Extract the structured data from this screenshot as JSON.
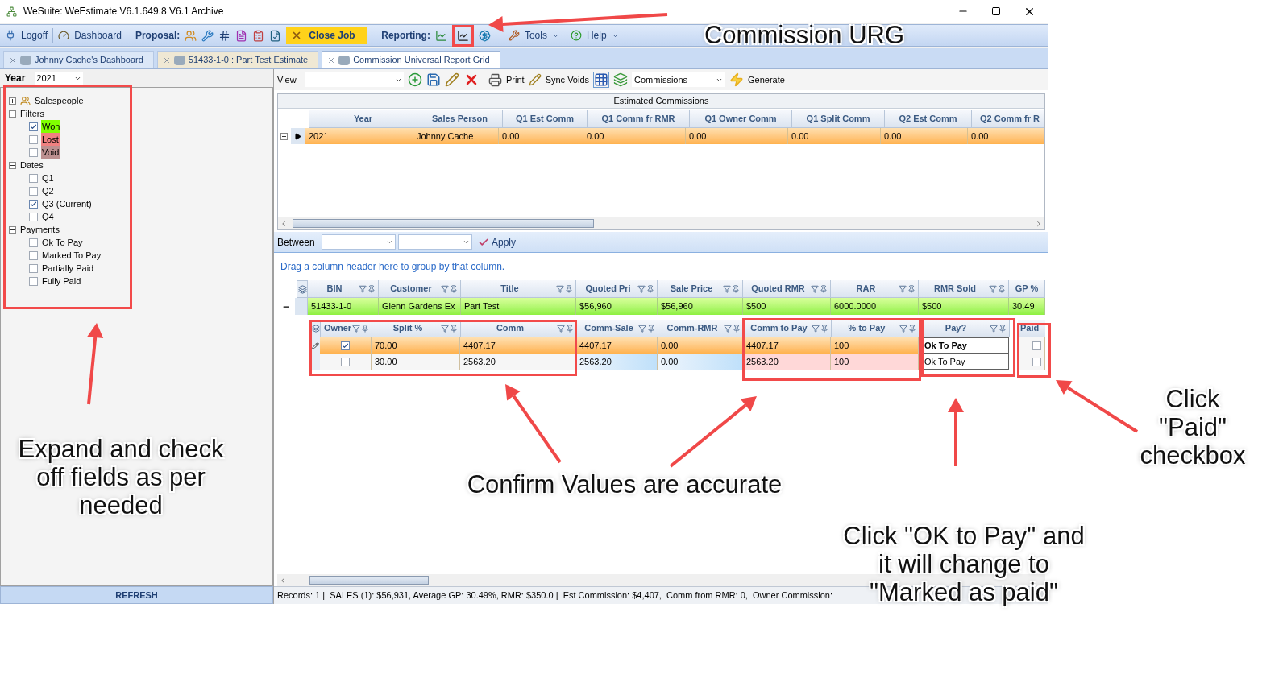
{
  "window": {
    "title": "WeSuite: WeEstimate V6.1.649.8 V6.1 Archive"
  },
  "toolbar": {
    "logoff": "Logoff",
    "dashboard": "Dashboard",
    "proposal_label": "Proposal:",
    "close_job": "Close Job",
    "reporting_label": "Reporting:",
    "menus": [
      "Tools",
      "Help"
    ]
  },
  "tabs": [
    {
      "label": "Johnny Cache's Dashboard",
      "selected": false
    },
    {
      "label": "51433-1-0 : Part Test Estimate",
      "selected": false
    },
    {
      "label": "Commission Universal Report Grid",
      "selected": true
    }
  ],
  "filter_panel": {
    "year_label": "Year",
    "year_value": "2021",
    "refresh": "REFRESH",
    "tree": [
      {
        "label": "Salespeople",
        "expanded": false
      },
      {
        "label": "Filters",
        "expanded": true,
        "children": [
          {
            "label": "Won",
            "checked": true,
            "color": "#80ff00"
          },
          {
            "label": "Lost",
            "checked": false,
            "color": "#f08080"
          },
          {
            "label": "Void",
            "checked": false,
            "color": "#bc8f8f"
          }
        ]
      },
      {
        "label": "Dates",
        "expanded": true,
        "children": [
          {
            "label": "Q1",
            "checked": false
          },
          {
            "label": "Q2",
            "checked": false
          },
          {
            "label": "Q3 (Current)",
            "checked": true
          },
          {
            "label": "Q4",
            "checked": false
          }
        ]
      },
      {
        "label": "Payments",
        "expanded": true,
        "children": [
          {
            "label": "Ok To Pay",
            "checked": false
          },
          {
            "label": "Marked To Pay",
            "checked": false
          },
          {
            "label": "Partially Paid",
            "checked": false
          },
          {
            "label": "Fully Paid",
            "checked": false
          }
        ]
      }
    ]
  },
  "report_toolbar": {
    "view_label": "View",
    "print": "Print",
    "sync_voids": "Sync Voids",
    "report": "Commissions",
    "generate": "Generate"
  },
  "estimated_grid": {
    "title": "Estimated Commissions",
    "columns": [
      "Year",
      "Sales Person",
      "Q1 Est Comm",
      "Q1 Comm fr RMR",
      "Q1 Owner Comm",
      "Q1 Split Comm",
      "Q2 Est Comm",
      "Q2 Comm fr R"
    ],
    "rows": [
      {
        "selected": true,
        "expanded": false,
        "cells": [
          "2021",
          "Johnny Cache",
          "0.00",
          "0.00",
          "0.00",
          "0.00",
          "0.00",
          "0.00"
        ]
      }
    ]
  },
  "between_bar": {
    "label": "Between",
    "apply": "Apply"
  },
  "group_hint": "Drag a column header here to group by that column.",
  "master_grid": {
    "columns": [
      {
        "label": "BIN",
        "filter": true
      },
      {
        "label": "Customer",
        "filter": true
      },
      {
        "label": "Title",
        "filter": true
      },
      {
        "label": "Quoted Pri",
        "filter": true
      },
      {
        "label": "Sale Price",
        "filter": true
      },
      {
        "label": "Quoted RMR",
        "filter": true
      },
      {
        "label": "RAR",
        "filter": true
      },
      {
        "label": "RMR Sold",
        "filter": true
      },
      {
        "label": "GP %",
        "filter": false
      }
    ],
    "rows": [
      {
        "expanded": true,
        "cells": [
          "51433-1-0",
          "Glenn Gardens Ex",
          "Part Test",
          "$56,960",
          "$56,960",
          "$500",
          "6000.0000",
          "$500",
          "30.49"
        ]
      }
    ]
  },
  "detail_grid": {
    "columns": [
      {
        "label": "Owner",
        "filter": true
      },
      {
        "label": "Split %",
        "filter": true
      },
      {
        "label": "Comm",
        "filter": true
      },
      {
        "label": "Comm-Sale",
        "filter": true
      },
      {
        "label": "Comm-RMR",
        "filter": true
      },
      {
        "label": "Comm to Pay",
        "filter": true
      },
      {
        "label": "% to Pay",
        "filter": true
      },
      {
        "label": "Pay?",
        "filter": true
      },
      {
        "label": "Paid",
        "filter": false
      }
    ],
    "rows": [
      {
        "selected": true,
        "cells": [
          {
            "kind": "checkbox",
            "checked": true
          },
          {
            "kind": "text",
            "text": "70.00"
          },
          {
            "kind": "text",
            "text": "4407.17"
          },
          {
            "kind": "text",
            "text": "4407.17"
          },
          {
            "kind": "text",
            "text": "0.00"
          },
          {
            "kind": "text",
            "text": "4407.17"
          },
          {
            "kind": "text",
            "text": "100"
          },
          {
            "kind": "field",
            "text": "Ok To Pay"
          },
          {
            "kind": "checkbox",
            "checked": false
          }
        ]
      },
      {
        "selected": false,
        "cells": [
          {
            "kind": "checkbox",
            "checked": false
          },
          {
            "kind": "text",
            "text": "30.00"
          },
          {
            "kind": "text",
            "text": "2563.20"
          },
          {
            "kind": "text",
            "text": "2563.20"
          },
          {
            "kind": "text",
            "text": "0.00"
          },
          {
            "kind": "text",
            "text": "2563.20"
          },
          {
            "kind": "text",
            "text": "100"
          },
          {
            "kind": "field",
            "text": "Ok To Pay"
          },
          {
            "kind": "checkbox",
            "checked": false
          }
        ]
      }
    ]
  },
  "status_bar": "Records: 1 |  SALES (1): $56,931, Average GP: 30.49%, RMR: $350.0 |  Est Commission: $4,407,  Comm from RMR: 0,  Owner Commission:",
  "callouts": [
    {
      "lines": [
        "Commission URG"
      ]
    },
    {
      "lines": [
        "Expand and check",
        "off fields as per",
        "needed"
      ]
    },
    {
      "lines": [
        "Confirm Values are accurate"
      ]
    },
    {
      "lines": [
        "Click \"OK to Pay\" and",
        "it will change to",
        "\"Marked as paid\""
      ]
    },
    {
      "lines": [
        "Click",
        "\"Paid\"",
        "checkbox"
      ]
    }
  ]
}
